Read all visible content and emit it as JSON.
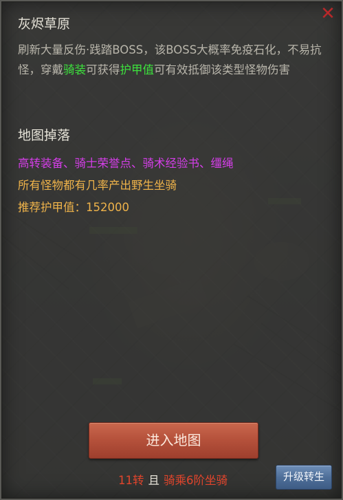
{
  "panel": {
    "title": "灰烬草原",
    "description_parts": {
      "p1": "刷新大量反伤·践踏BOSS，该BOSS大概率免疫石化，不易抗怪，穿戴",
      "p2": "骑装",
      "p3": "可获得",
      "p4": "护甲值",
      "p5": "可有效抵御该类型怪物伤害"
    },
    "section_title": "地图掉落",
    "drops": "高转装备、骑士荣誉点、骑术经验书、缰绳",
    "mount_note": "所有怪物都有几率产出野生坐骑",
    "armor_recommend": "推荐护甲值：152000"
  },
  "actions": {
    "enter_label": "进入地图",
    "upgrade_label": "升级转生"
  },
  "requirement": {
    "rebirth": "11转",
    "and": "且",
    "mount": "骑乘6阶坐骑"
  },
  "colors": {
    "highlight_green": "#3de33d",
    "drops_purple": "#d43ee8",
    "info_orange": "#efb34a",
    "requirement_red": "#e2452c",
    "close_red": "#b8282a"
  },
  "icons": {
    "close": "close-icon"
  }
}
